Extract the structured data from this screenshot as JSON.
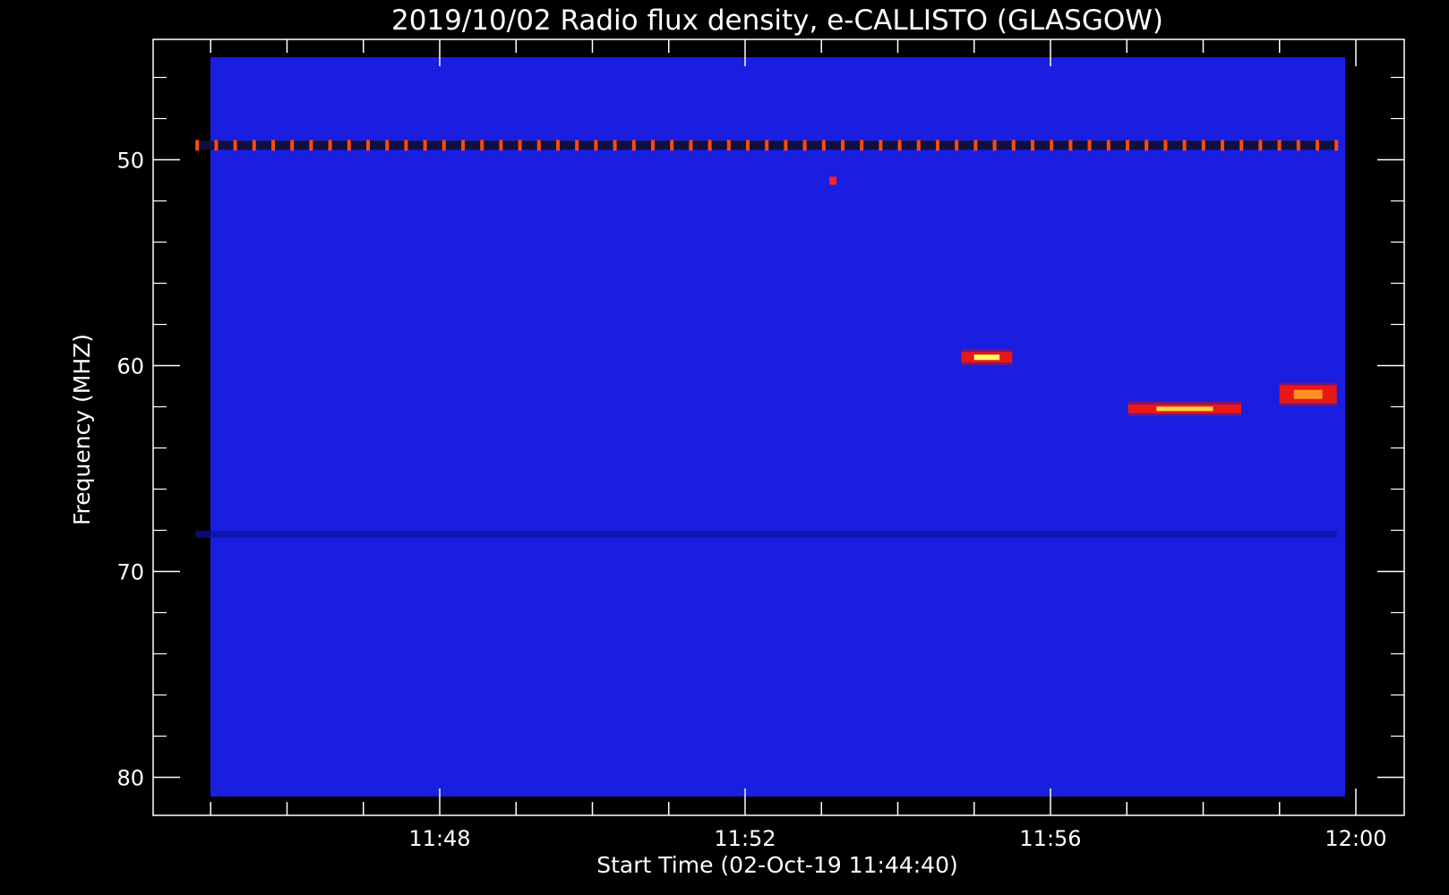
{
  "chart_data": {
    "type": "heatmap",
    "title": "2019/10/02  Radio flux density, e-CALLISTO (GLASGOW)",
    "xlabel": "Start Time (02-Oct-19 11:44:40)",
    "ylabel": "Frequency (MHZ)",
    "x_unit": "time (hh:mm)",
    "xlim": [
      "11:44:40",
      "11:59:45"
    ],
    "ylim": [
      45.0,
      81.0
    ],
    "y_inverted": true,
    "x_ticks": [
      "11:48",
      "11:52",
      "11:56",
      "12:00"
    ],
    "y_ticks": [
      50,
      60,
      70,
      80
    ],
    "colormap": {
      "background": "#1a1ee0",
      "low": "#1414b4",
      "mid": "#e01010",
      "high": "#ffff60"
    },
    "features": [
      {
        "name": "periodic interference line",
        "freq_mhz": 49.3,
        "t_start": "11:44:48",
        "t_end": "11:59:45",
        "peak_color": "#ff4a10"
      },
      {
        "name": "isolated pixel",
        "freq_mhz": 51.0,
        "t": "11:53:09",
        "peak_color": "#ff2020"
      },
      {
        "name": "short burst",
        "freq_mhz": 59.6,
        "t_start": "11:54:50",
        "t_end": "11:55:30",
        "peak_color": "#ffff60"
      },
      {
        "name": "drifting band",
        "freq_mhz": 62.1,
        "t_start": "11:57:01",
        "t_end": "11:58:30",
        "peak_color": "#ffd040"
      },
      {
        "name": "strong band",
        "freq_mhz": 61.4,
        "t_start": "11:59:00",
        "t_end": "11:59:45",
        "peak_color": "#ff9020"
      },
      {
        "name": "dark interference line",
        "freq_mhz": 68.2,
        "t_start": "11:44:48",
        "t_end": "11:59:45",
        "peak_color": "#1010a0"
      }
    ]
  }
}
